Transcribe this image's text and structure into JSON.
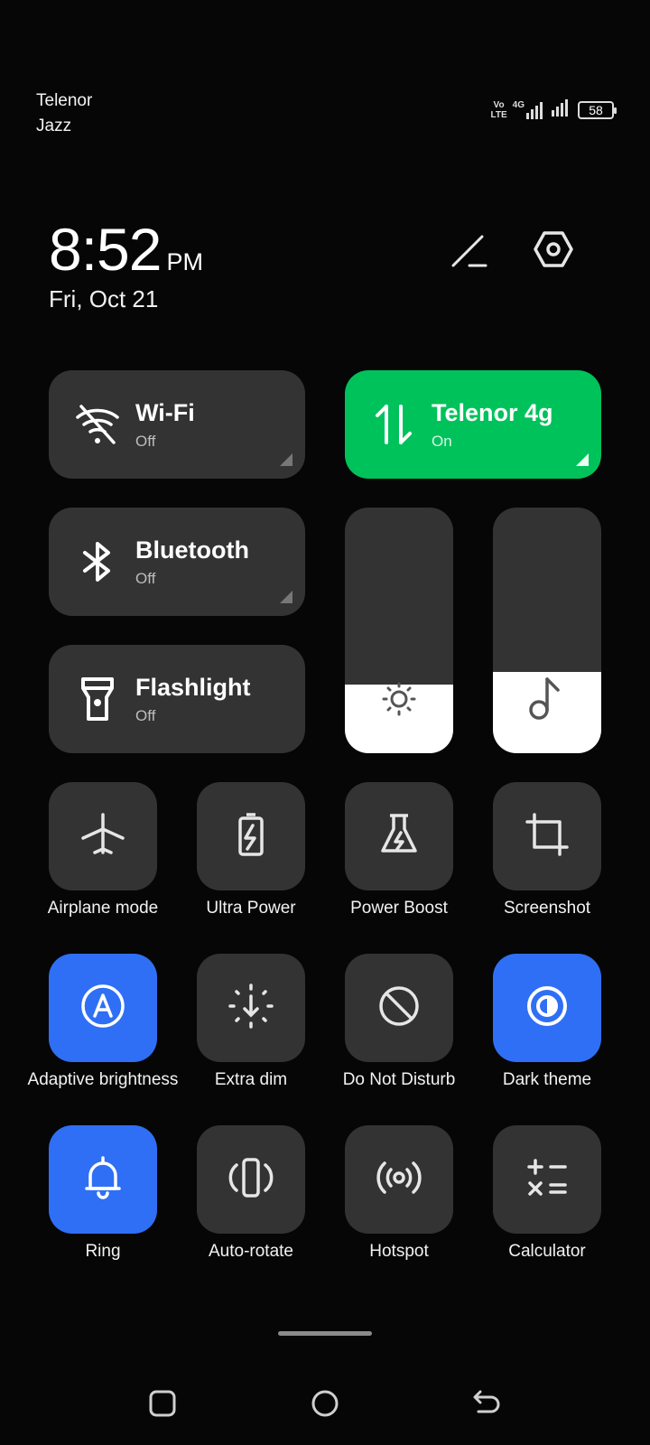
{
  "status_bar": {
    "carrier_1": "Telenor",
    "carrier_2": "Jazz",
    "volte_top": "Vo",
    "volte_bottom": "LTE",
    "network_type": "4G",
    "battery": "58"
  },
  "header": {
    "time": "8:52",
    "ampm": "PM",
    "date": "Fri, Oct 21",
    "edit_icon": "pencil-icon",
    "settings_icon": "settings-hexagon-icon"
  },
  "big_tiles": [
    {
      "title": "Wi-Fi",
      "status": "Off",
      "icon": "wifi-off-icon",
      "active": false
    },
    {
      "title": "Telenor 4g",
      "status": "On",
      "icon": "mobile-data-icon",
      "active": true,
      "color": "#00c25b"
    },
    {
      "title": "Bluetooth",
      "status": "Off",
      "icon": "bluetooth-icon",
      "active": false
    },
    {
      "title": "Flashlight",
      "status": "Off",
      "icon": "flashlight-icon",
      "active": false
    }
  ],
  "sliders": {
    "brightness": {
      "icon": "brightness-icon",
      "level": 0.28
    },
    "volume": {
      "icon": "music-note-icon",
      "level": 0.33
    }
  },
  "small_tiles": [
    {
      "label": "Airplane mode",
      "icon": "airplane-icon",
      "active": false
    },
    {
      "label": "Ultra Power",
      "icon": "battery-bolt-icon",
      "active": false
    },
    {
      "label": "Power Boost",
      "icon": "flask-bolt-icon",
      "active": false
    },
    {
      "label": "Screenshot",
      "icon": "crop-icon",
      "active": false
    },
    {
      "label": "Adaptive brightness",
      "icon": "auto-brightness-icon",
      "active": true
    },
    {
      "label": "Extra dim",
      "icon": "extra-dim-icon",
      "active": false
    },
    {
      "label": "Do Not Disturb",
      "icon": "do-not-disturb-icon",
      "active": false
    },
    {
      "label": "Dark theme",
      "icon": "dark-theme-icon",
      "active": true
    },
    {
      "label": "Ring",
      "icon": "bell-icon",
      "active": true
    },
    {
      "label": "Auto-rotate",
      "icon": "auto-rotate-icon",
      "active": false
    },
    {
      "label": "Hotspot",
      "icon": "hotspot-icon",
      "active": false
    },
    {
      "label": "Calculator",
      "icon": "calculator-icon",
      "active": false
    }
  ],
  "colors": {
    "active_blue": "#2f6ff5",
    "data_green": "#00c25b",
    "tile_bg": "#333333"
  },
  "nav": {
    "recents_icon": "square-icon",
    "home_icon": "circle-icon",
    "back_icon": "back-arrow-icon"
  }
}
